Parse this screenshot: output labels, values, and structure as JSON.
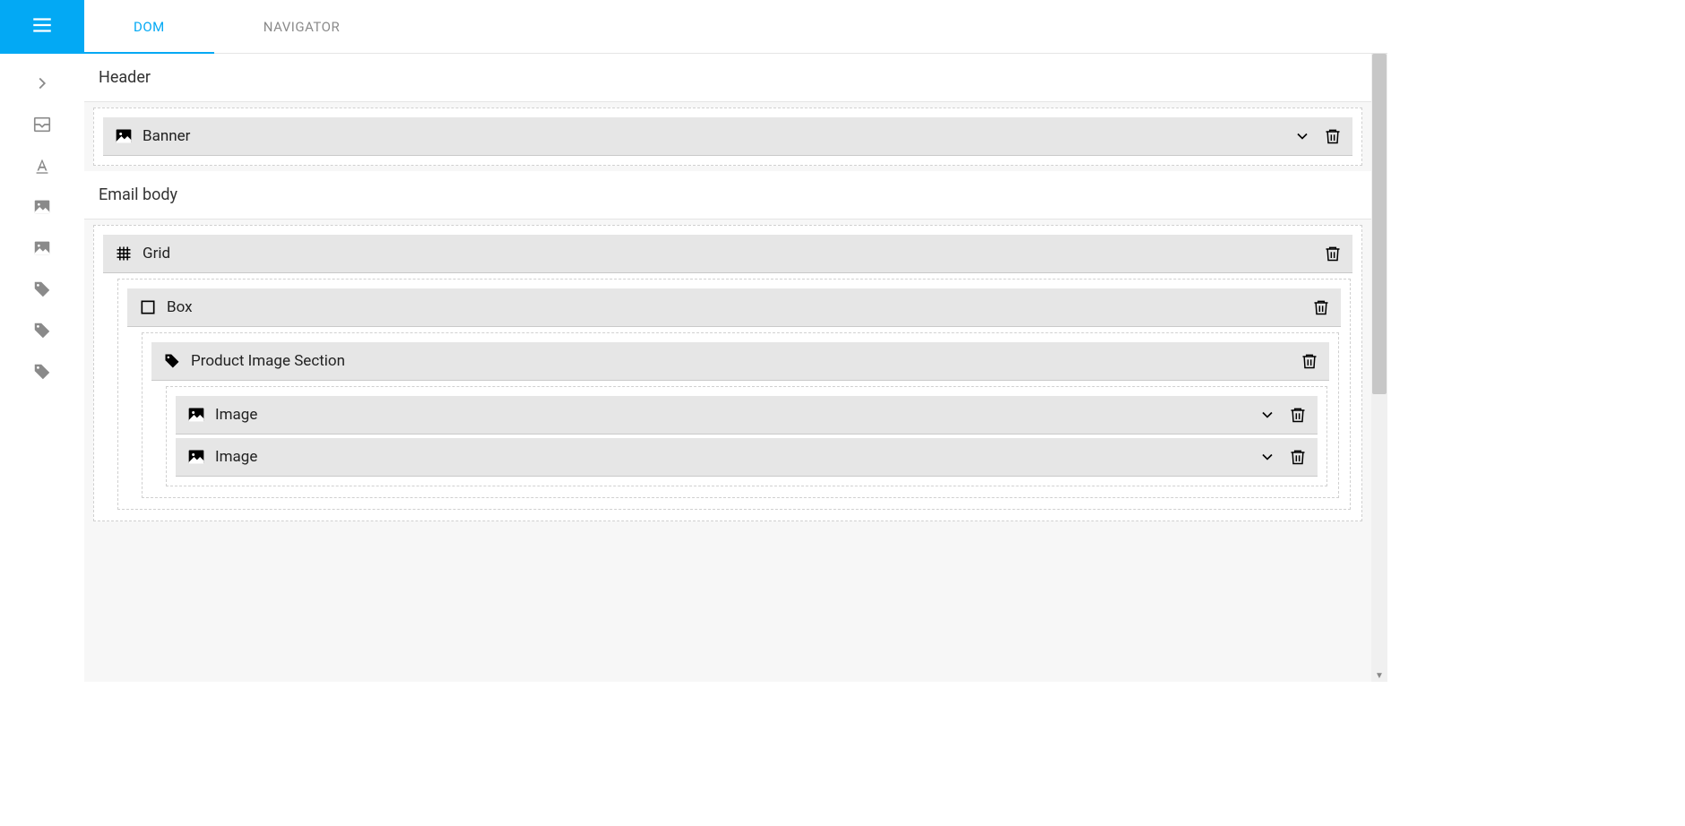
{
  "tabs": {
    "dom": "DOM",
    "navigator": "NAVIGATOR"
  },
  "sections": {
    "header": "Header",
    "emailBody": "Email body"
  },
  "nodes": {
    "banner": "Banner",
    "grid": "Grid",
    "box": "Box",
    "productImageSection": "Product Image Section",
    "image1": "Image",
    "image2": "Image"
  }
}
